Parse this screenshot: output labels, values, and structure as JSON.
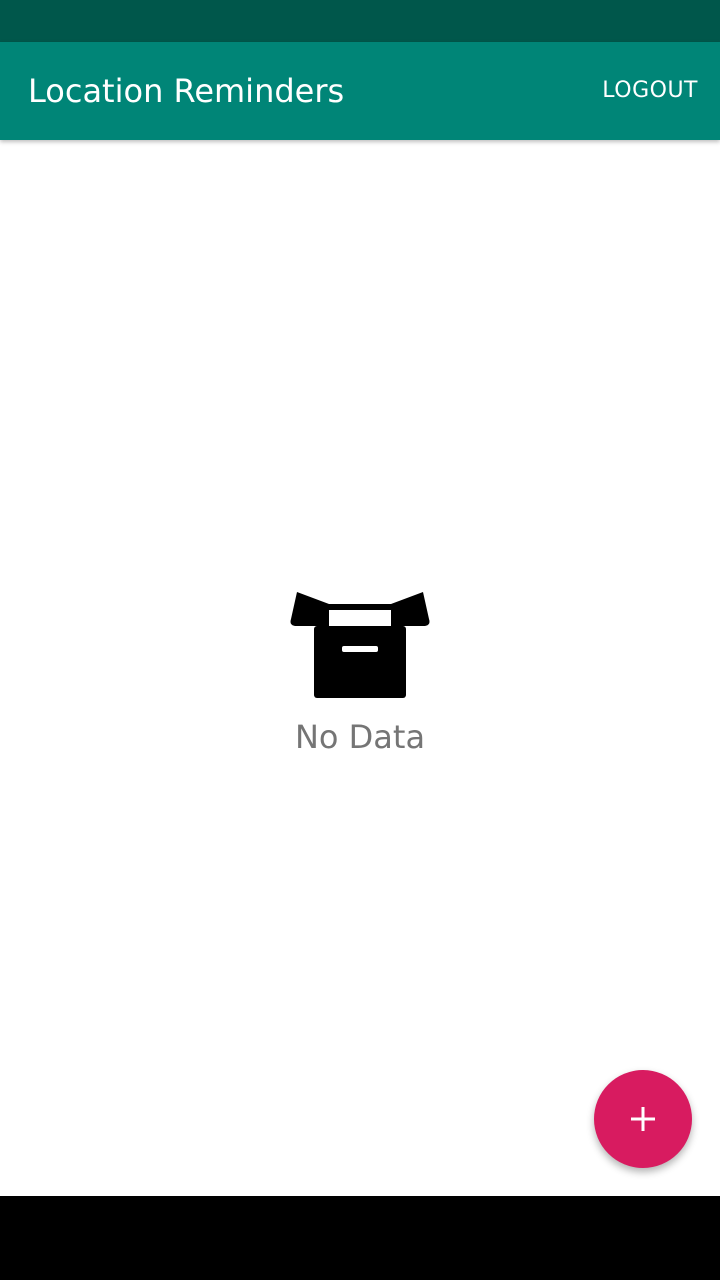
{
  "theme": {
    "status_bar_color": "#00574B",
    "app_bar_color": "#008577",
    "fab_color": "#D81B60",
    "nav_bar_color": "#000000"
  },
  "app_bar": {
    "title": "Location Reminders",
    "logout_label": "LOGOUT"
  },
  "empty_state": {
    "icon": "archive-box-icon",
    "text": "No Data"
  },
  "fab": {
    "icon": "plus-icon"
  }
}
